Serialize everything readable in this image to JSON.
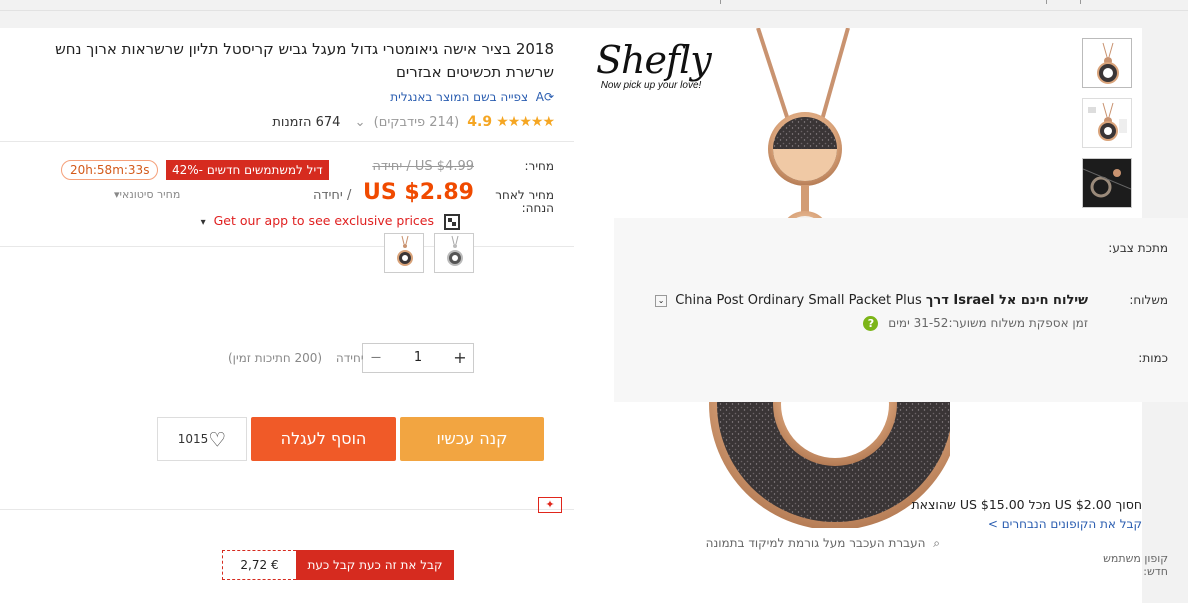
{
  "colors": {
    "accent": "#f04a00",
    "buy_now": "#f2a541",
    "add_cart": "#f05a28",
    "deal": "#d62b1f",
    "stars": "#f5a623",
    "link": "#2a5db0"
  },
  "brand": {
    "logo": "Shefly",
    "tagline": "Now pick up your love!"
  },
  "product": {
    "title": "2018 בציר אישה גיאומטרי גדול מעגל גביש קריסטל תליון שרשראות ארוך נחש שרשרת תכשיטים אבזרים",
    "translate_link": "צפייה בשם המוצר באנגלית",
    "rating": {
      "stars": "★★★★★",
      "score": "4.9",
      "reviews": "(214 פידבקים)",
      "chevron": "⌄",
      "orders": "674 הזמנות"
    }
  },
  "price": {
    "label": "מחיר:",
    "original": "US $4.99 / יחידה",
    "discount_label": "מחיר לאחר הנחה:",
    "current": "US $2.89",
    "unit": "/ יחידה",
    "deal_badge": "דיל למשתמשים חדשים -42%",
    "timer": "20h:58m:33s",
    "app_promo": "Get our app to see exclusive prices",
    "app_caret": "▾",
    "wholesale": "מחיר סיטונאי▾"
  },
  "color": {
    "label": "מתכת צבע:"
  },
  "shipping": {
    "label": "משלוח:",
    "line_bold": "שילוח חינם אל Israel דרך",
    "method": "China Post Ordinary Small Packet Plus",
    "select_icon": "⌄",
    "estimate": "זמן אספקת משלוח משוער:31-52  ימים"
  },
  "quantity": {
    "label": "כמות:",
    "value": "1",
    "minus": "—",
    "plus": "+",
    "unit": "יחידה",
    "available": "(200 חתיכות זמין)"
  },
  "actions": {
    "buy_now": "קנה עכשיו",
    "add_to_cart": "הוסף לעגלה",
    "wishlist_count": "1015",
    "heart": "♡"
  },
  "coupons": {
    "icon": "✦",
    "save": "חסוך US $2.00 מכל US $15.00 שהוצאת",
    "more_link": "קבל את הקופונים הנבחרים >",
    "new_user_label": "קופון משתמש חדש:",
    "amount": "2,72 €",
    "take": "קבל את זה כעת קבל כעת"
  },
  "gallery": {
    "zoom_hint": "העברת העכבר מעל גורמת למיקוד בתמונה",
    "zoom_icon": "⌕"
  }
}
